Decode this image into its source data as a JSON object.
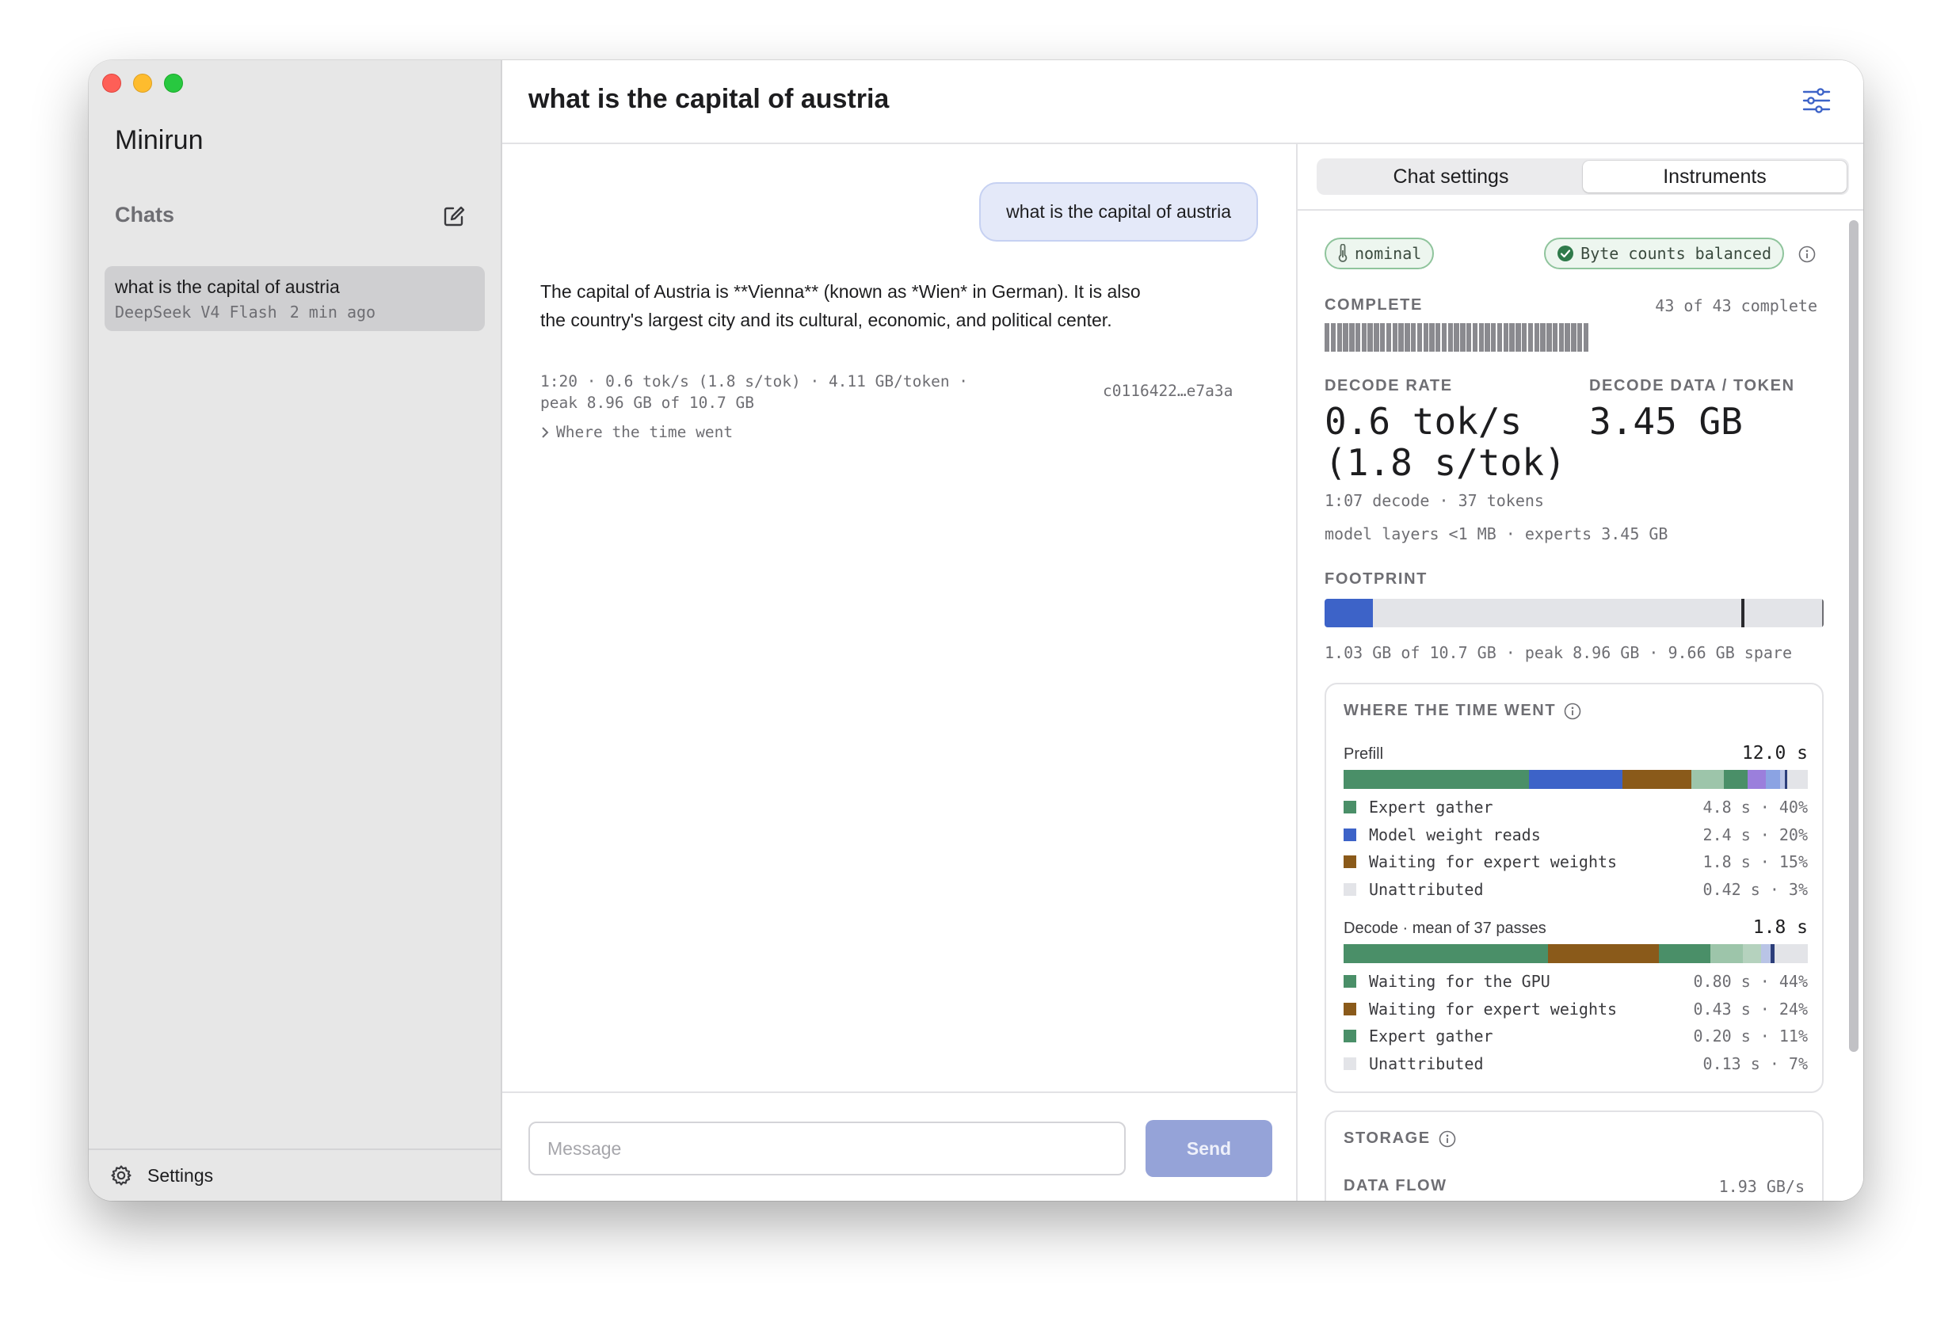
{
  "app": {
    "name": "Minirun"
  },
  "sidebar": {
    "chats_header": "Chats",
    "chats": [
      {
        "title": "what is the capital of austria",
        "model": "DeepSeek V4 Flash",
        "time": "2 min ago"
      }
    ],
    "settings_label": "Settings"
  },
  "header": {
    "title": "what is the capital of austria"
  },
  "conversation": {
    "user_message": "what is the capital of austria",
    "assistant_message": "The capital of Austria is **Vienna** (known as *Wien* in German). It is also the country's largest city and its cultural, economic, and political center.",
    "stats": "1:20 · 0.6 tok/s (1.8 s/tok) · 4.11 GB/token · peak 8.96 GB of 10.7 GB",
    "hash": "c0116422…e7a3a",
    "time_toggle": "Where the time went"
  },
  "composer": {
    "placeholder": "Message",
    "send_label": "Send"
  },
  "panel": {
    "tabs": [
      {
        "label": "Chat settings"
      },
      {
        "label": "Instruments"
      }
    ],
    "active_tab": "Instruments",
    "thermal_status": "nominal",
    "balance_status": "Byte counts balanced",
    "complete": {
      "label": "COMPLETE",
      "summary": "43 of 43 complete",
      "done": 43,
      "total": 43
    },
    "decode_rate": {
      "label": "DECODE RATE",
      "value_line1": "0.6 tok/s",
      "value_line2": "(1.8 s/tok)",
      "sub": "1:07 decode · 37 tokens"
    },
    "decode_data": {
      "label": "DECODE DATA / TOKEN",
      "value": "3.45 GB"
    },
    "layers_line": "model layers <1 MB · experts 3.45 GB",
    "footprint": {
      "label": "FOOTPRINT",
      "used_gb": 1.03,
      "peak_gb": 8.96,
      "total_gb": 10.7,
      "summary": "1.03 GB of 10.7 GB · peak 8.96 GB · 9.66 GB spare"
    },
    "time_went": {
      "title": "WHERE THE TIME WENT",
      "prefill": {
        "name": "Prefill",
        "total": "12.0 s",
        "segments": [
          {
            "fraction": 0.4,
            "color": "#4a8f68"
          },
          {
            "fraction": 0.2,
            "color": "#3d63c8"
          },
          {
            "fraction": 0.15,
            "color": "#8a5a1a"
          },
          {
            "fraction": 0.07,
            "color": "#9dc5aa"
          },
          {
            "fraction": 0.05,
            "color": "#4a8f68"
          },
          {
            "fraction": 0.04,
            "color": "#9b7fdc"
          },
          {
            "fraction": 0.03,
            "color": "#8ba3e3"
          },
          {
            "fraction": 0.01,
            "color": "#b9c4e6"
          },
          {
            "fraction": 0.005,
            "color": "#2c3e7a"
          }
        ],
        "legend": [
          {
            "name": "Expert gather",
            "value": "4.8 s · 40%",
            "color": "#4a8f68"
          },
          {
            "name": "Model weight reads",
            "value": "2.4 s · 20%",
            "color": "#3d63c8"
          },
          {
            "name": "Waiting for expert weights",
            "value": "1.8 s · 15%",
            "color": "#8a5a1a"
          },
          {
            "name": "Unattributed",
            "value": "0.42 s · 3%",
            "color": "#e3e4e8"
          }
        ]
      },
      "decode": {
        "name": "Decode · mean of 37 passes",
        "total": "1.8 s",
        "segments": [
          {
            "fraction": 0.44,
            "color": "#4a8f68"
          },
          {
            "fraction": 0.24,
            "color": "#8a5a1a"
          },
          {
            "fraction": 0.11,
            "color": "#4a8f68"
          },
          {
            "fraction": 0.07,
            "color": "#9dc5aa"
          },
          {
            "fraction": 0.04,
            "color": "#b5d2be"
          },
          {
            "fraction": 0.02,
            "color": "#b9c4e6"
          },
          {
            "fraction": 0.008,
            "color": "#2c3e7a"
          }
        ],
        "legend": [
          {
            "name": "Waiting for the GPU",
            "value": "0.80 s · 44%",
            "color": "#4a8f68"
          },
          {
            "name": "Waiting for expert weights",
            "value": "0.43 s · 24%",
            "color": "#8a5a1a"
          },
          {
            "name": "Expert gather",
            "value": "0.20 s · 11%",
            "color": "#4a8f68"
          },
          {
            "name": "Unattributed",
            "value": "0.13 s · 7%",
            "color": "#e3e4e8"
          }
        ]
      }
    },
    "storage": {
      "title": "STORAGE",
      "data_flow_label": "DATA FLOW",
      "data_flow_value": "1.93 GB/s"
    }
  }
}
